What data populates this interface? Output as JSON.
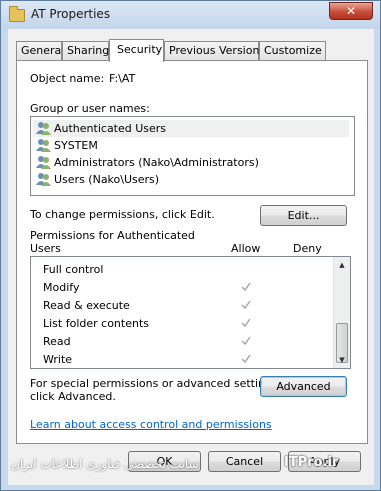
{
  "window": {
    "title": "AT Properties",
    "close_glyph": "✕"
  },
  "tabs": [
    {
      "label": "General"
    },
    {
      "label": "Sharing"
    },
    {
      "label": "Security"
    },
    {
      "label": "Previous Versions"
    },
    {
      "label": "Customize"
    }
  ],
  "security": {
    "object_name_label": "Object name:",
    "object_name_value": "F:\\AT",
    "group_label": "Group or user names:",
    "users": [
      {
        "name": "Authenticated Users",
        "icon": "users-group-icon"
      },
      {
        "name": "SYSTEM",
        "icon": "users-group-icon"
      },
      {
        "name": "Administrators (Nako\\Administrators)",
        "icon": "users-group-icon"
      },
      {
        "name": "Users (Nako\\Users)",
        "icon": "users-group-icon"
      }
    ],
    "change_text": "To change permissions, click Edit.",
    "edit_button": "Edit...",
    "permissions_for": "Permissions for Authenticated",
    "permissions_for_2": "Users",
    "allow_header": "Allow",
    "deny_header": "Deny",
    "permissions": [
      {
        "name": "Full control",
        "allow": false,
        "deny": false
      },
      {
        "name": "Modify",
        "allow": true,
        "deny": false
      },
      {
        "name": "Read & execute",
        "allow": true,
        "deny": false
      },
      {
        "name": "List folder contents",
        "allow": true,
        "deny": false
      },
      {
        "name": "Read",
        "allow": true,
        "deny": false
      },
      {
        "name": "Write",
        "allow": true,
        "deny": false
      }
    ],
    "special_text_1": "For special permissions or advanced settings,",
    "special_text_2": "click Advanced.",
    "advanced_button": "Advanced",
    "learn_link": "Learn about access control and permissions"
  },
  "footer": {
    "ok_button": "OK",
    "cancel_button": "Cancel",
    "apply_button": "Apply"
  },
  "watermark": {
    "text": "ITPro.ir",
    "text_fa": "سایت تخصصی فناوری اطلاعات ایران"
  }
}
